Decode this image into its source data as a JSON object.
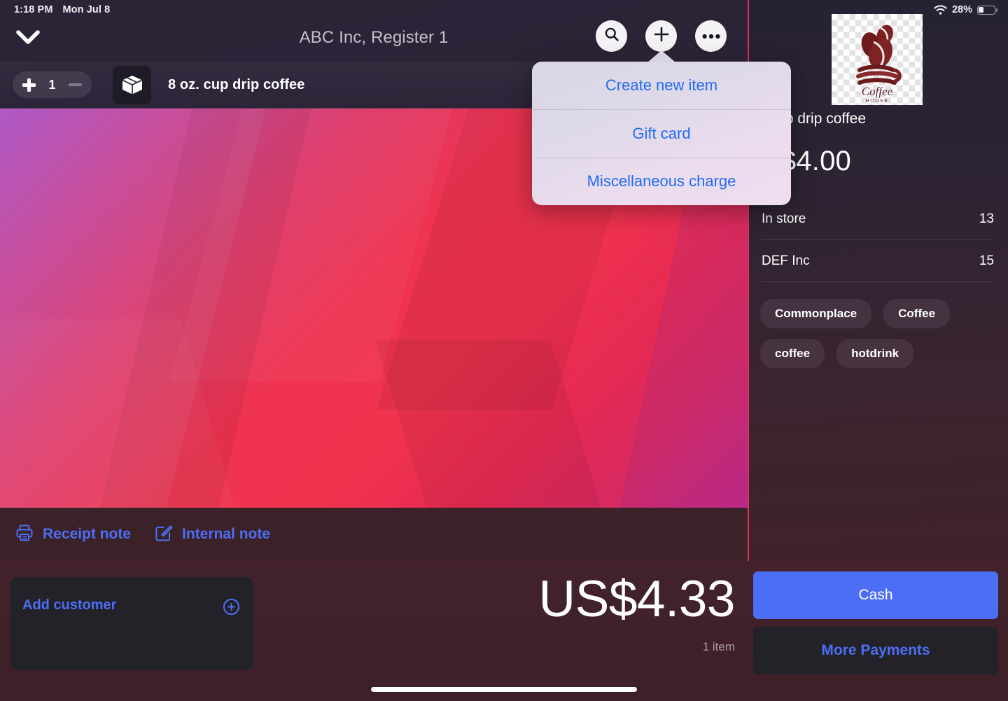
{
  "status_bar": {
    "time": "1:18 PM",
    "date": "Mon Jul 8",
    "battery_percent": "28%",
    "wifi_icon": "wifi-icon",
    "battery_icon": "battery-icon"
  },
  "nav": {
    "title": "ABC Inc, Register 1",
    "back_icon": "chevron-down-icon",
    "search_icon": "search-icon",
    "add_icon": "plus-icon",
    "more_icon": "ellipsis-icon"
  },
  "cart": {
    "quantity": "1",
    "item_name": "8 oz. cup drip coffee",
    "item_icon": "package-box-icon",
    "plus_icon": "plus-icon",
    "minus_icon": "minus-icon"
  },
  "notes": {
    "receipt_label": "Receipt note",
    "receipt_icon": "printer-icon",
    "internal_label": "Internal note",
    "internal_icon": "pencil-square-icon"
  },
  "popover": {
    "items": [
      {
        "label": "Create new item"
      },
      {
        "label": "Gift card"
      },
      {
        "label": "Miscellaneous charge"
      }
    ]
  },
  "detail": {
    "image_alt": "coffee-house-logo",
    "product_name": ". cup drip coffee",
    "price": "S$4.00",
    "inventory": [
      {
        "location": "In store",
        "count": "13"
      },
      {
        "location": "DEF Inc",
        "count": "15"
      }
    ],
    "tags": [
      "Commonplace",
      "Coffee",
      "coffee",
      "hotdrink"
    ]
  },
  "footer": {
    "add_customer_label": "Add customer",
    "add_customer_icon": "plus-circle-icon",
    "total": "US$4.33",
    "item_count": "1 item",
    "cash_label": "Cash",
    "more_payments_label": "More Payments"
  },
  "colors": {
    "accent_blue": "#4c6ef5",
    "link_blue": "#216bf5",
    "divider_pink": "#d9325f",
    "panel_dark": "#232228"
  }
}
